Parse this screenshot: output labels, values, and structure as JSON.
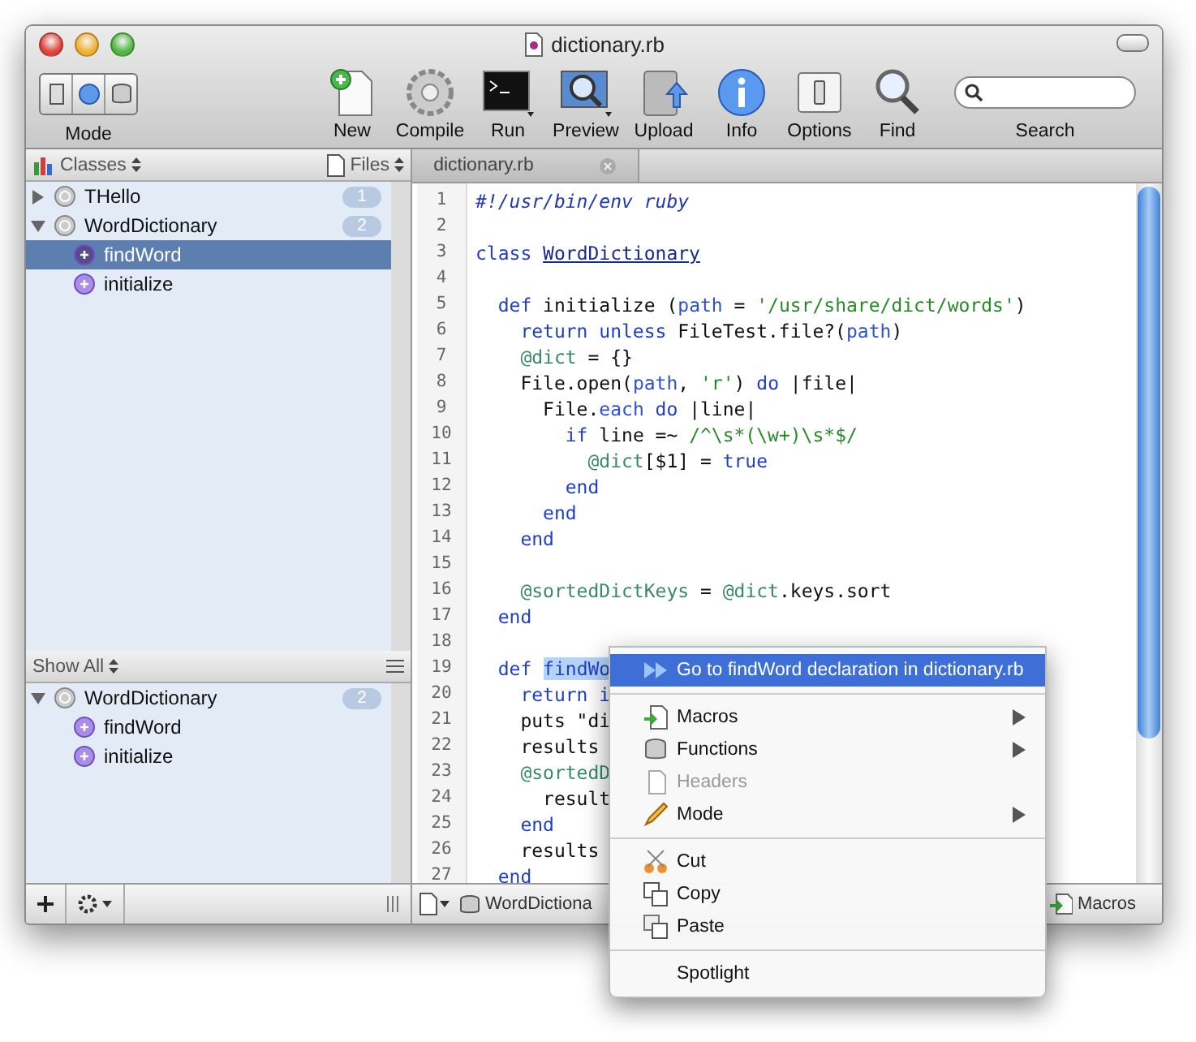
{
  "window": {
    "title": "dictionary.rb"
  },
  "toolbar": {
    "mode_label": "Mode",
    "buttons": [
      {
        "label": "New"
      },
      {
        "label": "Compile"
      },
      {
        "label": "Run"
      },
      {
        "label": "Preview"
      },
      {
        "label": "Upload"
      },
      {
        "label": "Info"
      },
      {
        "label": "Options"
      },
      {
        "label": "Find"
      }
    ],
    "search_label": "Search"
  },
  "sidebar": {
    "header": {
      "classes": "Classes",
      "files": "Files"
    },
    "tree": [
      {
        "label": "THello",
        "count": "1",
        "expanded": false,
        "selected": false
      },
      {
        "label": "WordDictionary",
        "count": "2",
        "expanded": true,
        "selected": false,
        "children": [
          {
            "label": "findWord",
            "selected": true
          },
          {
            "label": "initialize",
            "selected": false
          }
        ]
      }
    ],
    "filter": "Show All",
    "members": [
      {
        "label": "WordDictionary",
        "count": "2",
        "expanded": true,
        "selected": false,
        "children": [
          {
            "label": "findWord",
            "selected": false
          },
          {
            "label": "initialize",
            "selected": false
          }
        ]
      }
    ]
  },
  "tab": {
    "label": "dictionary.rb"
  },
  "code": [
    {
      "n": "1",
      "seg": [
        {
          "kind": "cmt",
          "text": "#!/usr/bin/env ruby"
        }
      ]
    },
    {
      "n": "2"
    },
    {
      "n": "3",
      "seg": [
        {
          "kind": "kw",
          "text": "class "
        },
        {
          "kind": "cls",
          "text": "WordDictionary"
        }
      ]
    },
    {
      "n": "4"
    },
    {
      "n": "5",
      "seg": [
        {
          "kind": "kw",
          "text": "  def "
        },
        {
          "kind": "plain",
          "text": "initialize ("
        },
        {
          "kind": "var",
          "text": "path"
        },
        {
          "kind": "plain",
          "text": " = "
        },
        {
          "kind": "str",
          "text": "'/usr/share/dict/words'"
        },
        {
          "kind": "plain",
          "text": ")"
        }
      ]
    },
    {
      "n": "6",
      "seg": [
        {
          "kind": "kw",
          "text": "    return unless "
        },
        {
          "kind": "plain",
          "text": "FileTest.file?("
        },
        {
          "kind": "var",
          "text": "path"
        },
        {
          "kind": "plain",
          "text": ")"
        }
      ]
    },
    {
      "n": "7",
      "seg": [
        {
          "kind": "ivar",
          "text": "    @dict"
        },
        {
          "kind": "plain",
          "text": " = {}"
        }
      ]
    },
    {
      "n": "8",
      "seg": [
        {
          "kind": "plain",
          "text": "    File.open("
        },
        {
          "kind": "var",
          "text": "path"
        },
        {
          "kind": "plain",
          "text": ", "
        },
        {
          "kind": "str",
          "text": "'r'"
        },
        {
          "kind": "plain",
          "text": ") "
        },
        {
          "kind": "kw",
          "text": "do"
        },
        {
          "kind": "plain",
          "text": " |file|"
        }
      ]
    },
    {
      "n": "9",
      "seg": [
        {
          "kind": "plain",
          "text": "      File."
        },
        {
          "kind": "var",
          "text": "each"
        },
        {
          "kind": "kw",
          "text": " do"
        },
        {
          "kind": "plain",
          "text": " |line|"
        }
      ]
    },
    {
      "n": "10",
      "seg": [
        {
          "kind": "kw",
          "text": "        if"
        },
        {
          "kind": "plain",
          "text": " line =~ "
        },
        {
          "kind": "str",
          "text": "/^\\s*(\\w+)\\s*$/"
        }
      ]
    },
    {
      "n": "11",
      "seg": [
        {
          "kind": "ivar",
          "text": "          @dict"
        },
        {
          "kind": "plain",
          "text": "[$1] = "
        },
        {
          "kind": "kw",
          "text": "true"
        }
      ]
    },
    {
      "n": "12",
      "seg": [
        {
          "kind": "kw",
          "text": "        end"
        }
      ]
    },
    {
      "n": "13",
      "seg": [
        {
          "kind": "kw",
          "text": "      end"
        }
      ]
    },
    {
      "n": "14",
      "seg": [
        {
          "kind": "kw",
          "text": "    end"
        }
      ]
    },
    {
      "n": "15"
    },
    {
      "n": "16",
      "seg": [
        {
          "kind": "ivar",
          "text": "    @sortedDictKeys"
        },
        {
          "kind": "plain",
          "text": " = "
        },
        {
          "kind": "ivar",
          "text": "@dict"
        },
        {
          "kind": "plain",
          "text": ".keys.sort"
        }
      ]
    },
    {
      "n": "17",
      "seg": [
        {
          "kind": "kw",
          "text": "  end"
        }
      ]
    },
    {
      "n": "18"
    },
    {
      "n": "19",
      "seg": [
        {
          "kind": "kw",
          "text": "  def "
        },
        {
          "kind": "sel",
          "text": "findWo"
        }
      ]
    },
    {
      "n": "20",
      "seg": [
        {
          "kind": "kw",
          "text": "    return i"
        }
      ]
    },
    {
      "n": "21",
      "seg": [
        {
          "kind": "plain",
          "text": "    puts \"di"
        }
      ]
    },
    {
      "n": "22",
      "seg": [
        {
          "kind": "plain",
          "text": "    results"
        }
      ]
    },
    {
      "n": "23",
      "seg": [
        {
          "kind": "ivar",
          "text": "    @sortedD"
        }
      ]
    },
    {
      "n": "24",
      "seg": [
        {
          "kind": "plain",
          "text": "      result"
        }
      ]
    },
    {
      "n": "25",
      "seg": [
        {
          "kind": "kw",
          "text": "    end"
        }
      ]
    },
    {
      "n": "26",
      "seg": [
        {
          "kind": "plain",
          "text": "    results"
        }
      ]
    },
    {
      "n": "27",
      "seg": [
        {
          "kind": "kw",
          "text": "  end"
        }
      ]
    }
  ],
  "status_bar": {
    "symbol": "WordDictiona",
    "macros": "Macros"
  },
  "context_menu": [
    {
      "kind": "item",
      "label": "Go to findWord declaration in dictionary.rb",
      "highlighted": true,
      "disabled": false,
      "submenu": false
    },
    {
      "kind": "separator"
    },
    {
      "kind": "item",
      "label": "Macros",
      "highlighted": false,
      "disabled": false,
      "submenu": true
    },
    {
      "kind": "item",
      "label": "Functions",
      "highlighted": false,
      "disabled": false,
      "submenu": true
    },
    {
      "kind": "item",
      "label": "Headers",
      "highlighted": false,
      "disabled": true,
      "submenu": false
    },
    {
      "kind": "item",
      "label": "Mode",
      "highlighted": false,
      "disabled": false,
      "submenu": true
    },
    {
      "kind": "separator"
    },
    {
      "kind": "item",
      "label": "Cut",
      "highlighted": false,
      "disabled": false,
      "submenu": false
    },
    {
      "kind": "item",
      "label": "Copy",
      "highlighted": false,
      "disabled": false,
      "submenu": false
    },
    {
      "kind": "item",
      "label": "Paste",
      "highlighted": false,
      "disabled": false,
      "submenu": false
    },
    {
      "kind": "separator"
    },
    {
      "kind": "item",
      "label": "Spotlight",
      "highlighted": false,
      "disabled": false,
      "submenu": false
    }
  ]
}
